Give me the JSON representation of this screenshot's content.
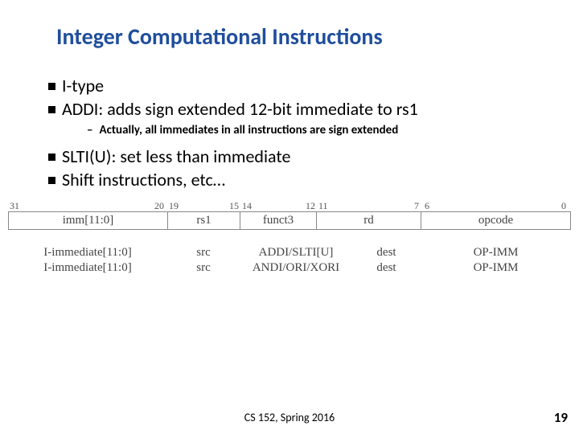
{
  "title": "Integer Computational Instructions",
  "bullets": {
    "b1": "I-type",
    "b2": "ADDI: adds sign extended 12-bit immediate to rs1",
    "sub1": "Actually, all immediates in all instructions are sign extended",
    "b3": "SLTI(U): set less than immediate",
    "b4": "Shift instructions, etc…"
  },
  "bits": {
    "b31": "31",
    "b20": "20",
    "b19": "19",
    "b15": "15",
    "b14": "14",
    "b12": "12",
    "b11": "11",
    "b7": "7",
    "b6": "6",
    "b0": "0"
  },
  "fields": {
    "imm": "imm[11:0]",
    "rs1": "rs1",
    "funct3": "funct3",
    "rd": "rd",
    "opcode": "opcode"
  },
  "row1": {
    "imm": "I-immediate[11:0]",
    "src": "src",
    "fn": "ADDI/SLTI[U]",
    "dest": "dest",
    "op": "OP-IMM"
  },
  "row2": {
    "imm": "I-immediate[11:0]",
    "src": "src",
    "fn": "ANDI/ORI/XORI",
    "dest": "dest",
    "op": "OP-IMM"
  },
  "footer": "CS 152, Spring 2016",
  "page": "19"
}
